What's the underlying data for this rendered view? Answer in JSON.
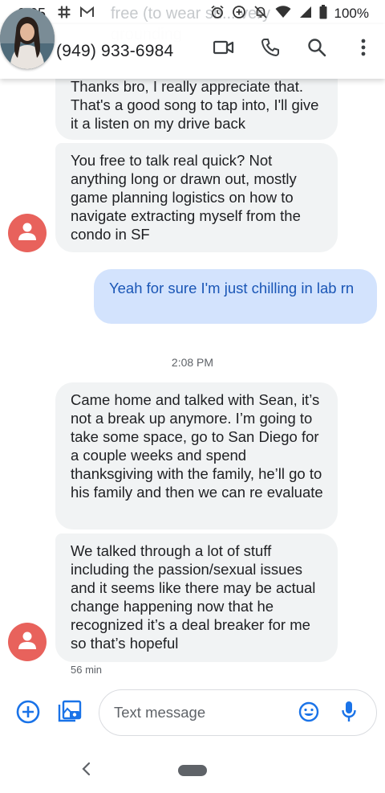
{
  "status_bar": {
    "time": "3:05",
    "battery_text": "100%",
    "left_icons": [
      "slack-icon",
      "gmail-icon"
    ],
    "right_icons": [
      "alarm-icon",
      "data-saver-icon",
      "notifications-off-icon",
      "wifi-icon",
      "signal-icon",
      "battery-icon"
    ]
  },
  "ghost_text": "free (to wear sh... very grounding",
  "header": {
    "contact_name": "(949) 933-6984",
    "actions": [
      "video-call-icon",
      "phone-icon",
      "search-icon",
      "more-options-icon"
    ]
  },
  "messages": [
    {
      "direction": "in",
      "text": "Thanks bro, I really appreciate that. That's a good song to tap into, I'll give it a listen on my drive back"
    },
    {
      "direction": "in",
      "text": "You free to talk real quick? Not anything long or drawn out, mostly game planning logistics on how to navigate extracting myself from the condo in SF"
    },
    {
      "direction": "out",
      "text": "Yeah for sure I'm just chilling in lab rn"
    },
    {
      "direction": "in",
      "text": "Came home and talked with Sean, it’s not a break up anymore. I’m going to take some space, go to San Diego for a couple weeks and spend thanksgiving with the family, he’ll go to his family and then we can re evaluate"
    },
    {
      "direction": "in",
      "text": "We talked through a lot of stuff including the passion/sexual issues and it seems like there may be actual change happening now that he recognized it’s a deal breaker for me so that’s hopeful"
    }
  ],
  "time_divider": "2:08 PM",
  "last_message_meta": "56 min",
  "compose": {
    "placeholder": "Text message"
  },
  "colors": {
    "incoming_bubble": "#f1f3f4",
    "outgoing_bubble": "#d3e3fd",
    "outgoing_text": "#1a56b6",
    "sender_avatar": "#e8625c",
    "accent": "#1a73e8"
  }
}
